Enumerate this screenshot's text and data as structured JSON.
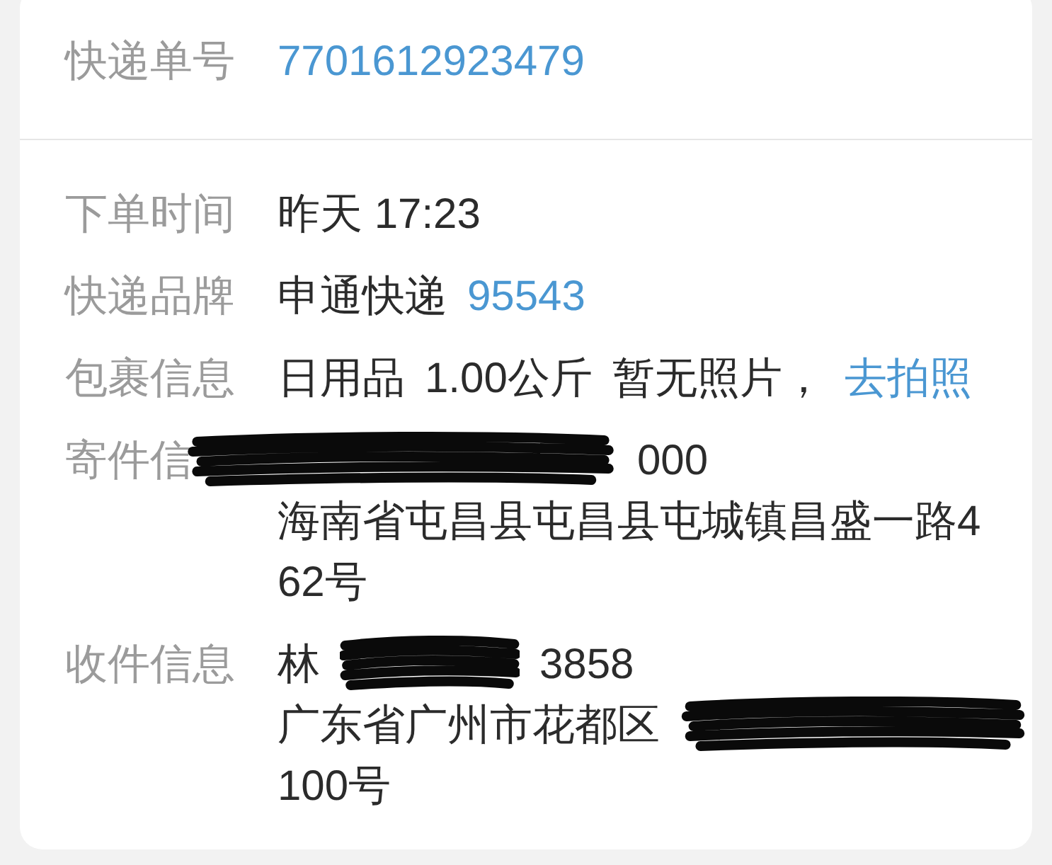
{
  "tracking": {
    "label": "快递单号",
    "number": "7701612923479"
  },
  "details": [
    {
      "label": "下单时间",
      "lines": [
        [
          {
            "kind": "text",
            "text": "昨天 17:23"
          }
        ]
      ]
    },
    {
      "label": "快递品牌",
      "lines": [
        [
          {
            "kind": "text",
            "text": "申通快递"
          },
          {
            "kind": "link",
            "text": "95543"
          }
        ]
      ]
    },
    {
      "label": "包裹信息",
      "lines": [
        [
          {
            "kind": "text",
            "text": "日用品"
          },
          {
            "kind": "text",
            "text": "1.00公斤"
          },
          {
            "kind": "text",
            "text": "暂无照片，"
          },
          {
            "kind": "link",
            "text": "去拍照"
          }
        ]
      ]
    },
    {
      "label": "寄件信",
      "lines": [
        [
          {
            "kind": "redacted"
          },
          {
            "kind": "text",
            "text": "000"
          }
        ],
        [
          {
            "kind": "text",
            "text": "海南省屯昌县屯昌县屯城镇昌盛一路462号"
          }
        ]
      ]
    },
    {
      "label": "收件信息",
      "lines": [
        [
          {
            "kind": "text",
            "text": "林"
          },
          {
            "kind": "redacted"
          },
          {
            "kind": "text",
            "text": "3858"
          }
        ],
        [
          {
            "kind": "text",
            "text": "广东省广州市花都区"
          },
          {
            "kind": "redacted"
          }
        ],
        [
          {
            "kind": "text",
            "text": "100号"
          }
        ]
      ]
    }
  ]
}
